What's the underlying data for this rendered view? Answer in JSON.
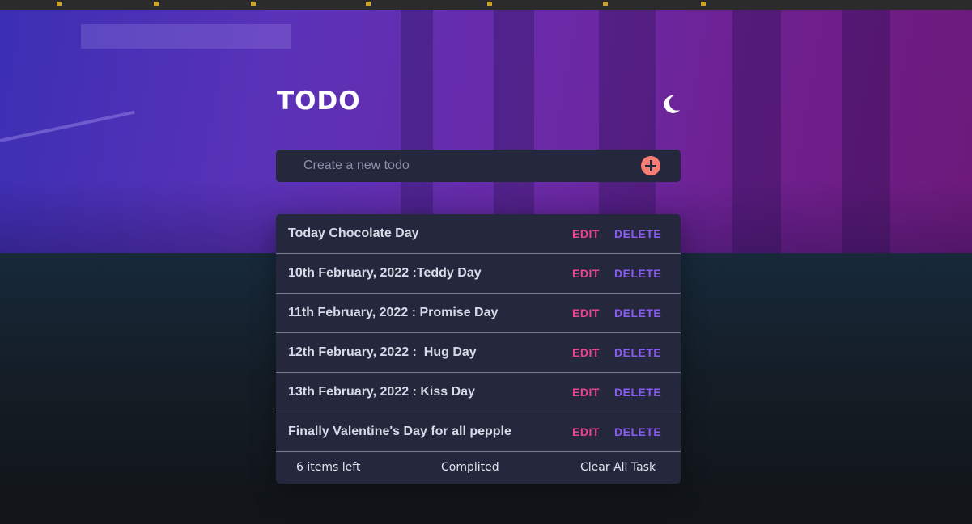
{
  "app": {
    "title": "TODO",
    "theme_icon": "moon-icon"
  },
  "new_todo": {
    "placeholder": "Create a new todo",
    "value": "",
    "add_icon": "plus-circle-icon"
  },
  "todos": [
    {
      "text": "Today Chocolate Day",
      "edit_label": "EDIT",
      "delete_label": "DELETE"
    },
    {
      "text": "10th February, 2022 :Teddy Day",
      "edit_label": "EDIT",
      "delete_label": "DELETE"
    },
    {
      "text": "11th February, 2022 : Promise Day",
      "edit_label": "EDIT",
      "delete_label": "DELETE"
    },
    {
      "text": "12th February, 2022 :  Hug Day",
      "edit_label": "EDIT",
      "delete_label": "DELETE"
    },
    {
      "text": "13th February, 2022 : Kiss Day",
      "edit_label": "EDIT",
      "delete_label": "DELETE"
    },
    {
      "text": "Finally Valentine's Day for all pepple",
      "edit_label": "EDIT",
      "delete_label": "DELETE"
    }
  ],
  "footer": {
    "items_left": "6 items left",
    "completed_label": "Complited",
    "clear_label": "Clear All Task"
  },
  "colors": {
    "accent_edit": "#e8448f",
    "accent_delete": "#8a5cf0",
    "add_button": "#fa7d73",
    "card_background": "#25273c"
  }
}
